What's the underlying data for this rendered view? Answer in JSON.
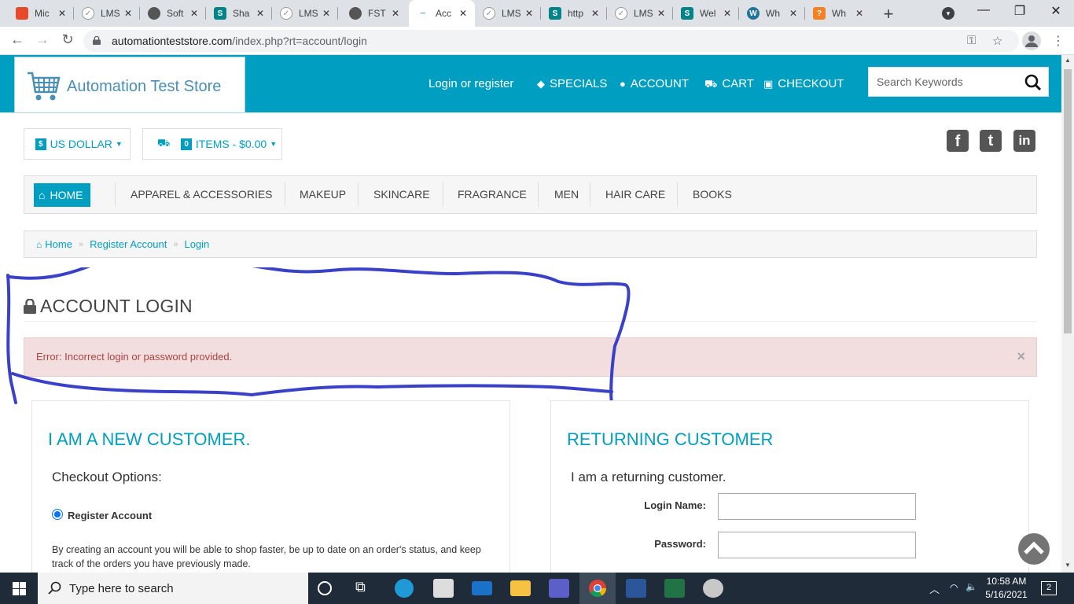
{
  "browser": {
    "tabs": [
      {
        "title": "Mic",
        "fav_color": "#e74a2a",
        "fav_glyph": "▮"
      },
      {
        "title": "LMS",
        "fav_color": "#9e9e9e",
        "fav_glyph": "✓"
      },
      {
        "title": "Soft",
        "fav_color": "#555555",
        "fav_glyph": "◍"
      },
      {
        "title": "Sha",
        "fav_color": "#038387",
        "fav_glyph": "S"
      },
      {
        "title": "LMS",
        "fav_color": "#9e9e9e",
        "fav_glyph": "✓"
      },
      {
        "title": "FST",
        "fav_color": "#555555",
        "fav_glyph": "◍"
      },
      {
        "title": "Acc",
        "fav_color": "#8fb8d8",
        "fav_glyph": "—"
      },
      {
        "title": "LMS",
        "fav_color": "#9e9e9e",
        "fav_glyph": "✓"
      },
      {
        "title": "http",
        "fav_color": "#038387",
        "fav_glyph": "S"
      },
      {
        "title": "LMS",
        "fav_color": "#9e9e9e",
        "fav_glyph": "✓"
      },
      {
        "title": "Wel",
        "fav_color": "#038387",
        "fav_glyph": "S"
      },
      {
        "title": "Wh",
        "fav_color": "#21759b",
        "fav_glyph": "W"
      },
      {
        "title": "Wh",
        "fav_color": "#f48024",
        "fav_glyph": "?"
      }
    ],
    "url_domain": "automationteststore.com",
    "url_path": "/index.php?rt=account/login"
  },
  "header": {
    "logo_text": "Automation Test Store",
    "login_link": "Login or register",
    "nav": [
      {
        "label": "SPECIALS",
        "icon": "tag-icon"
      },
      {
        "label": "ACCOUNT",
        "icon": "user-icon"
      },
      {
        "label": "CART",
        "icon": "cart-icon"
      },
      {
        "label": "CHECKOUT",
        "icon": "money-icon"
      }
    ],
    "search_placeholder": "Search Keywords",
    "brand_color": "#009fc2"
  },
  "currency": {
    "badge": "$",
    "label": "US DOLLAR"
  },
  "cart_summary": {
    "count": "0",
    "label": "ITEMS - $0.00"
  },
  "social": [
    "f",
    "t",
    "in"
  ],
  "menu": {
    "home": "HOME",
    "items": [
      "APPAREL & ACCESSORIES",
      "MAKEUP",
      "SKINCARE",
      "FRAGRANCE",
      "MEN",
      "HAIR CARE",
      "BOOKS"
    ]
  },
  "breadcrumb": [
    "Home",
    "Register Account",
    "Login"
  ],
  "page": {
    "title": "ACCOUNT LOGIN",
    "error": "Error: Incorrect login or password provided.",
    "close_glyph": "×"
  },
  "new_customer": {
    "heading": "I AM A NEW CUSTOMER.",
    "sub": "Checkout Options:",
    "option": "Register Account",
    "description": "By creating an account you will be able to shop faster, be up to date on an order's status, and keep track of the orders you have previously made."
  },
  "returning_customer": {
    "heading": "RETURNING CUSTOMER",
    "sub": "I am a returning customer.",
    "login_label": "Login Name:",
    "password_label": "Password:"
  },
  "taskbar": {
    "search_placeholder": "Type here to search",
    "time": "10:58 AM",
    "date": "5/16/2021",
    "notifications": "2"
  }
}
